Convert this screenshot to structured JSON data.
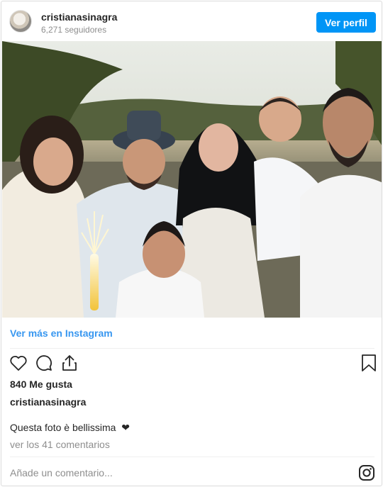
{
  "header": {
    "username": "cristianasinagra",
    "followers": "6,271 seguidores",
    "profile_button": "Ver perfil"
  },
  "post": {
    "view_more": "Ver más en Instagram",
    "likes": "840 Me gusta",
    "caption_user": "cristianasinagra",
    "caption_text": "Questa foto è bellissima",
    "caption_emoji": "❤",
    "view_comments": "ver los 41 comentarios"
  },
  "actions": {
    "icons": [
      "heart-icon",
      "comment-icon",
      "share-icon",
      "bookmark-icon"
    ]
  },
  "comment": {
    "placeholder": "Añade un comentario..."
  },
  "colors": {
    "accent": "#0095f6",
    "link": "#3897f0",
    "muted": "#8e8e8e",
    "text": "#262626"
  }
}
